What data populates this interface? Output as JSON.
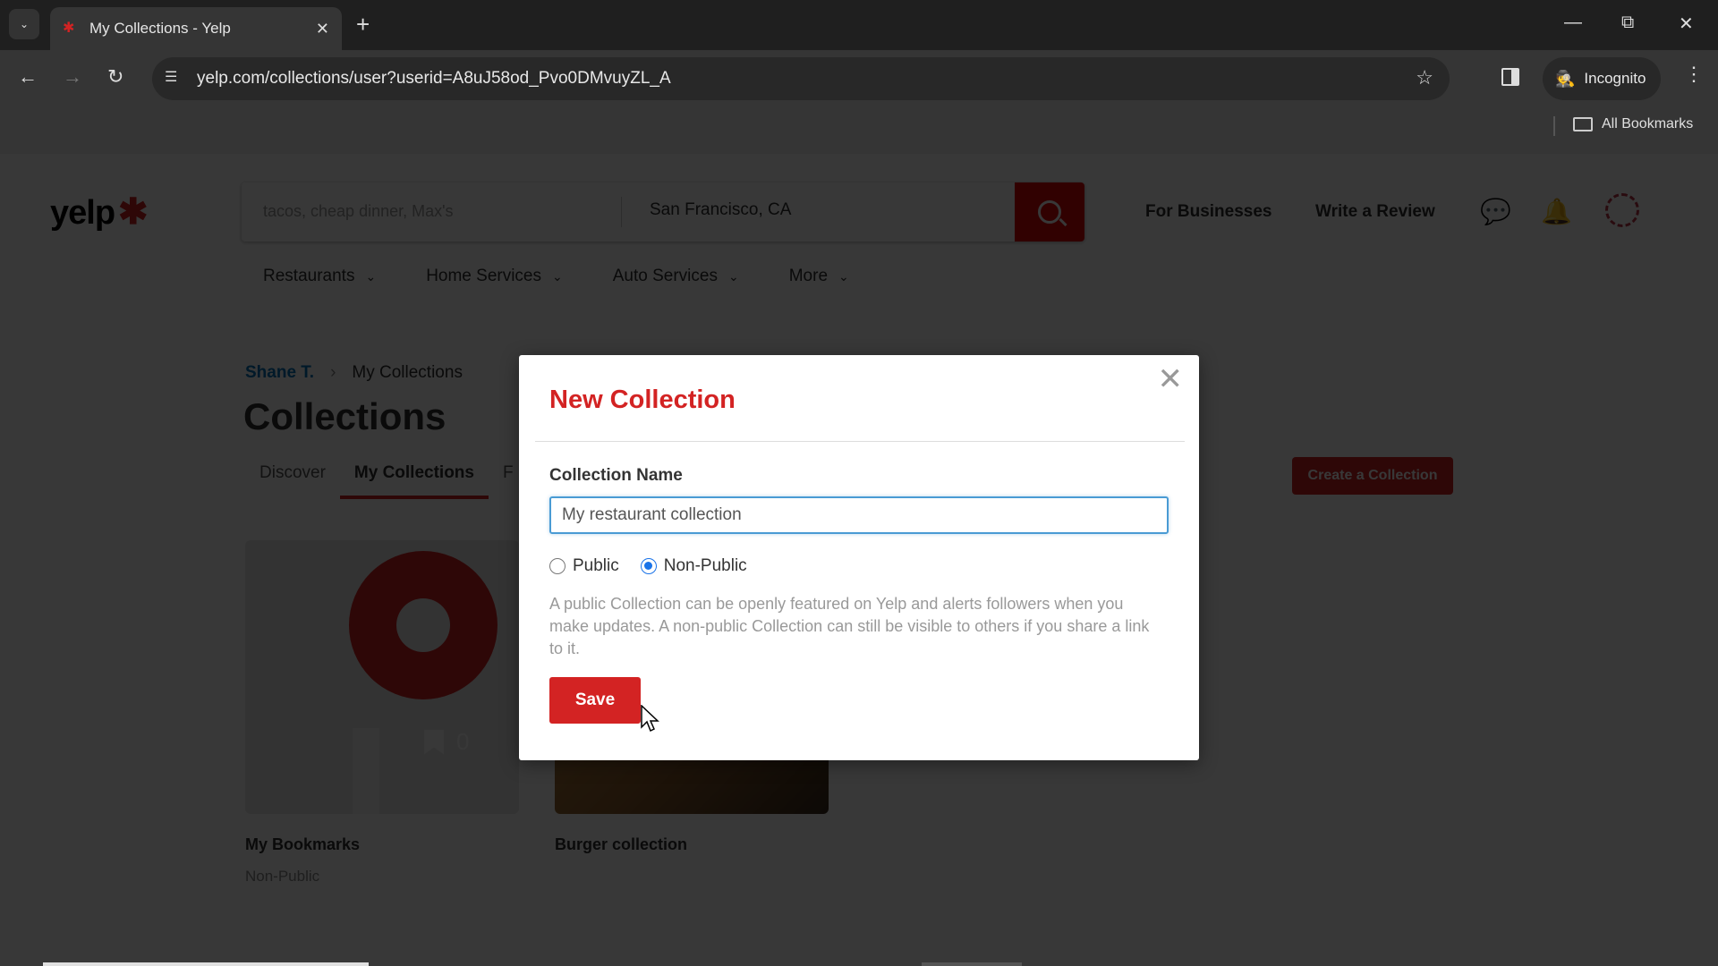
{
  "browser": {
    "tab_title": "My Collections - Yelp",
    "url": "yelp.com/collections/user?userid=A8uJ58od_Pvo0DMvuyZL_A",
    "incognito_label": "Incognito",
    "all_bookmarks_label": "All Bookmarks"
  },
  "header": {
    "logo_text": "yelp",
    "search_placeholder": "tacos, cheap dinner, Max's",
    "location_value": "San Francisco, CA",
    "for_businesses": "For Businesses",
    "write_review": "Write a Review",
    "categories": [
      "Restaurants",
      "Home Services",
      "Auto Services",
      "More"
    ]
  },
  "breadcrumb": {
    "user": "Shane T.",
    "current": "My Collections"
  },
  "page": {
    "title": "Collections",
    "tabs": [
      "Discover",
      "My Collections",
      "F"
    ],
    "active_tab": "My Collections",
    "create_button": "Create a Collection"
  },
  "collections": [
    {
      "title": "My Bookmarks",
      "visibility": "Non-Public",
      "count": "0"
    },
    {
      "title": "Burger collection",
      "visibility": ""
    }
  ],
  "modal": {
    "title": "New Collection",
    "field_label": "Collection Name",
    "name_value": "My restaurant collection",
    "radio_public": "Public",
    "radio_nonpublic": "Non-Public",
    "selected_visibility": "Non-Public",
    "help_text": "A public Collection can be openly featured on Yelp and alerts followers when you make updates. A non-public Collection can still be visible to others if you share a link to it.",
    "save_label": "Save"
  },
  "colors": {
    "brand_red": "#d32323",
    "radio_blue": "#1a73e8",
    "input_focus": "#4a9bd4"
  }
}
